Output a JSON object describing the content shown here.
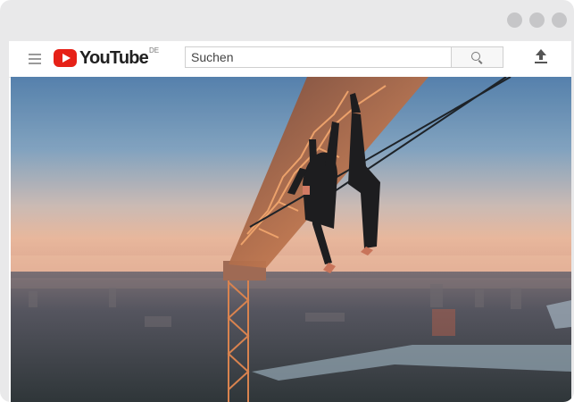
{
  "window": {
    "controls": [
      "dot-1",
      "dot-2",
      "dot-3"
    ]
  },
  "header": {
    "menu_icon": "hamburger-menu-icon",
    "logo_text": "YouTube",
    "country_code": "DE",
    "search_placeholder": "Suchen",
    "search_icon": "search-icon",
    "upload_icon": "upload-icon"
  },
  "colors": {
    "brand_red": "#e62117",
    "frame": "#e9e9ea",
    "sky_top": "#4a78a6",
    "sky_horizon": "#e5b89a"
  },
  "video": {
    "scene": "crane-climbers-city-sunset"
  }
}
